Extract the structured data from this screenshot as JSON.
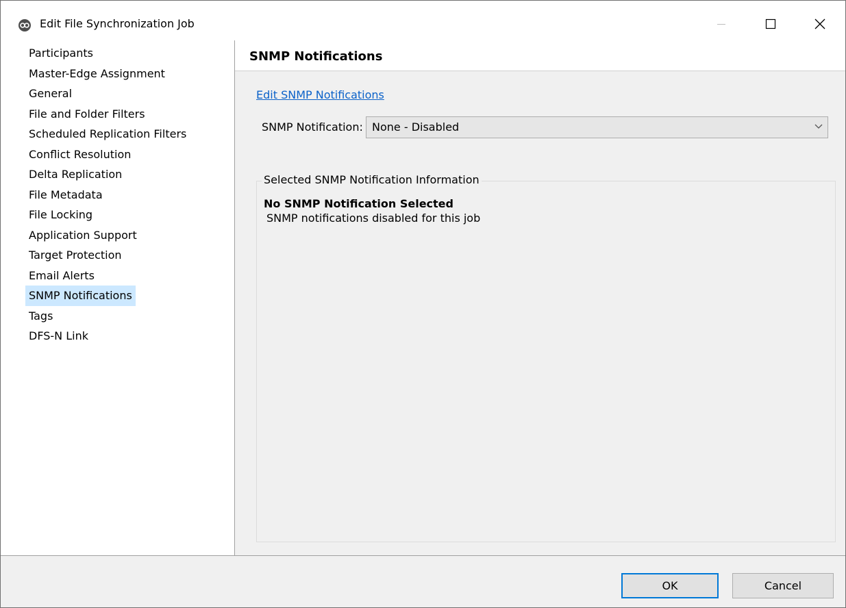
{
  "window": {
    "title": "Edit File Synchronization Job",
    "app_icon": "app-logo-icon",
    "controls": [
      "minimize-icon",
      "maximize-icon",
      "close-icon"
    ]
  },
  "sidebar": {
    "items": [
      {
        "label": "Participants"
      },
      {
        "label": "Master-Edge Assignment"
      },
      {
        "label": "General"
      },
      {
        "label": "File and Folder Filters"
      },
      {
        "label": "Scheduled Replication Filters"
      },
      {
        "label": "Conflict Resolution"
      },
      {
        "label": "Delta Replication"
      },
      {
        "label": "File Metadata"
      },
      {
        "label": "File Locking"
      },
      {
        "label": "Application Support"
      },
      {
        "label": "Target Protection"
      },
      {
        "label": "Email Alerts"
      },
      {
        "label": "SNMP Notifications",
        "selected": true
      },
      {
        "label": "Tags"
      },
      {
        "label": "DFS-N Link"
      }
    ],
    "selected_color": "#cce8ff"
  },
  "main": {
    "header_title": "SNMP Notifications",
    "edit_link": "Edit SNMP Notifications",
    "select_label": "SNMP Notification:",
    "select_value": "None - Disabled",
    "group_title": "Selected SNMP Notification Information",
    "info_title": "No SNMP Notification Selected",
    "info_desc": "SNMP notifications disabled for this job",
    "link_color": "#0b62c9"
  },
  "footer": {
    "ok_label": "OK",
    "cancel_label": "Cancel",
    "accent": "#0078d7"
  }
}
